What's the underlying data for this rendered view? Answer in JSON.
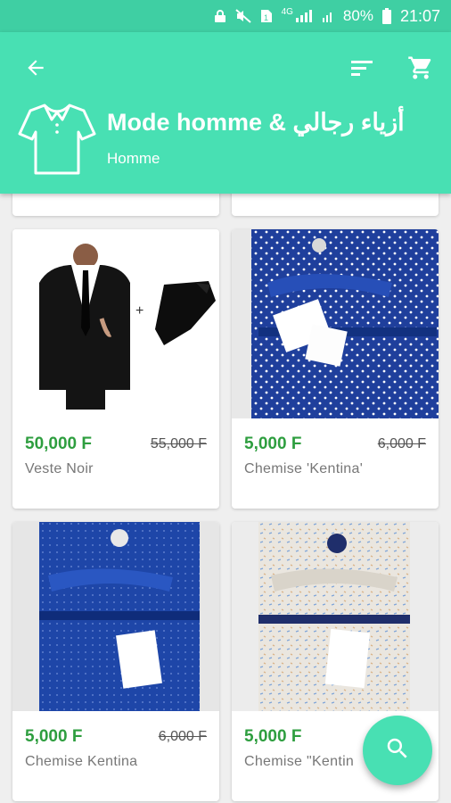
{
  "status_bar": {
    "battery": "80%",
    "time": "21:07",
    "network": "4G"
  },
  "header": {
    "title": "Mode homme & أزياء رجالي",
    "subtitle": "Homme",
    "icons": [
      "back-arrow-icon",
      "sort-icon",
      "cart-icon",
      "shirt-category-icon"
    ]
  },
  "products": [
    {
      "price": "50,000 F",
      "old_price": "55,000 F",
      "name": "Veste Noir",
      "image": "black-suit-and-tie"
    },
    {
      "price": "5,000 F",
      "old_price": "6,000 F",
      "name": "Chemise 'Kentina'",
      "image": "blue-dotted-shirt"
    },
    {
      "price": "5,000 F",
      "old_price": "6,000 F",
      "name": "Chemise Kentina",
      "image": "blue-micro-print-shirt"
    },
    {
      "price": "5,000 F",
      "old_price": "",
      "name": "Chemise  \"Kentin",
      "image": "white-blue-print-shirt"
    }
  ],
  "fab": {
    "icon": "search-icon"
  },
  "colors": {
    "header": "#48e0b3",
    "status_bar": "#3fcfa3",
    "price": "#2e9e3f"
  }
}
